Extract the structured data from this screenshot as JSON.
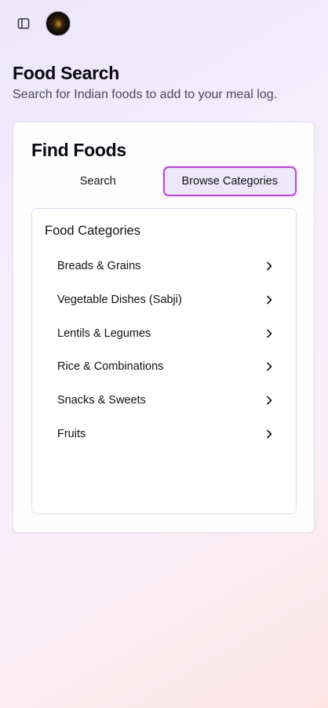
{
  "header": {
    "sidebar_toggle_icon": "panel-left-icon",
    "avatar_icon": "avatar"
  },
  "page": {
    "title": "Food Search",
    "subtitle": "Search for Indian foods to add to your meal log."
  },
  "card": {
    "title": "Find Foods",
    "tabs": [
      {
        "label": "Search",
        "active": false
      },
      {
        "label": "Browse Categories",
        "active": true
      }
    ],
    "panel": {
      "title": "Food Categories",
      "items": [
        {
          "label": "Breads & Grains"
        },
        {
          "label": "Vegetable Dishes (Sabji)"
        },
        {
          "label": "Lentils & Legumes"
        },
        {
          "label": "Rice & Combinations"
        },
        {
          "label": "Snacks & Sweets"
        },
        {
          "label": "Fruits"
        }
      ],
      "item_icon": "chevron-right-icon"
    }
  },
  "colors": {
    "accent_border": "#b94ad6",
    "active_tab_bg": "#ede7fb",
    "text": "#0b0b12",
    "muted_text": "#4a4a56"
  }
}
